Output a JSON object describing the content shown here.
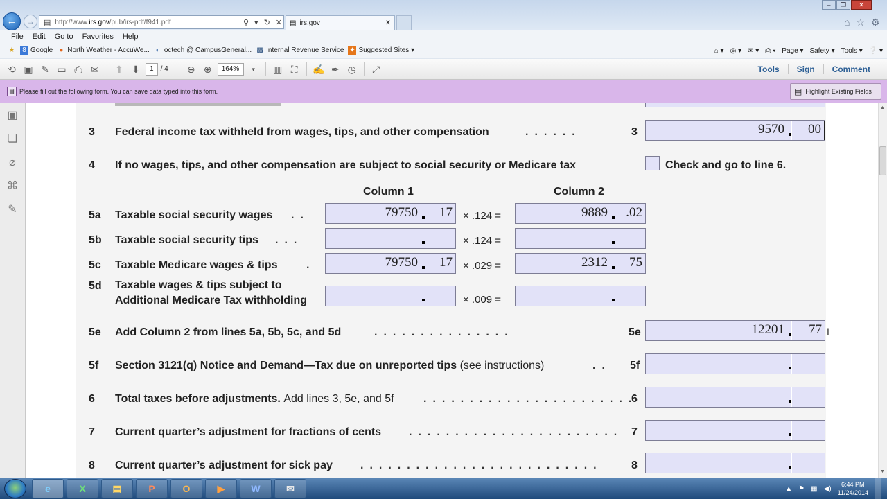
{
  "browser": {
    "url_prefix": "http://www.",
    "url_host": "irs.gov",
    "url_path": "/pub/irs-pdf/f941.pdf",
    "tab_title": "irs.gov",
    "search_glyph": "⚲",
    "refresh_glyph": "↻",
    "close_glyph": "✕"
  },
  "menu": [
    "File",
    "Edit",
    "Go to",
    "Favorites",
    "Help"
  ],
  "favorites": [
    "Google",
    "North Weather - AccuWe...",
    "octech @ CampusGeneral...",
    "Internal Revenue Service",
    "Suggested Sites ▾"
  ],
  "command_bar": [
    "Page ▾",
    "Safety ▾",
    "Tools ▾",
    "❔ ▾"
  ],
  "pdf_toolbar": {
    "page_current": "1",
    "page_total": "/ 4",
    "zoom": "164%",
    "tools": "Tools",
    "sign": "Sign",
    "comment": "Comment"
  },
  "notice": {
    "text": "Please fill out the following form. You can save data typed into this form.",
    "highlight_button": "Highlight Existing Fields"
  },
  "form": {
    "line3": {
      "num": "3",
      "label": "Federal income tax withheld from wages, tips, and other compensation",
      "ref": "3",
      "dollars": "9570",
      "cents": "00"
    },
    "line4": {
      "num": "4",
      "label": "If no wages, tips, and other compensation are subject to social security or Medicare tax",
      "check_label": "Check and go to line 6."
    },
    "col1": "Column 1",
    "col2": "Column 2",
    "line5a": {
      "num": "5a",
      "label": "Taxable social security wages",
      "mult": "× .124 =",
      "c1_dollars": "79750",
      "c1_cents": "17",
      "c2_dollars": "9889",
      "c2_cents": ".02"
    },
    "line5b": {
      "num": "5b",
      "label": "Taxable social security tips",
      "mult": "× .124 =",
      "c1_dollars": "",
      "c1_cents": "",
      "c2_dollars": "",
      "c2_cents": ""
    },
    "line5c": {
      "num": "5c",
      "label": "Taxable Medicare wages & tips",
      "mult": "× .029 =",
      "c1_dollars": "79750",
      "c1_cents": "17",
      "c2_dollars": "2312",
      "c2_cents": "75"
    },
    "line5d": {
      "num": "5d",
      "label1": "Taxable wages & tips subject to",
      "label2": "Additional Medicare Tax withholding",
      "mult": "× .009 =",
      "c1_dollars": "",
      "c1_cents": "",
      "c2_dollars": "",
      "c2_cents": ""
    },
    "line5e": {
      "num": "5e",
      "label": "Add Column 2 from lines 5a, 5b, 5c, and 5d",
      "ref": "5e",
      "dollars": "12201",
      "cents": "77"
    },
    "line5f": {
      "num": "5f",
      "label": "Section 3121(q) Notice and Demand—Tax due on unreported tips",
      "label_note": "(see instructions)",
      "ref": "5f",
      "dollars": "",
      "cents": ""
    },
    "line6": {
      "num": "6",
      "label": "Total taxes before adjustments.",
      "label_note": "Add lines 3, 5e, and 5f",
      "ref": "6",
      "dollars": "",
      "cents": ""
    },
    "line7": {
      "num": "7",
      "label": "Current quarter’s adjustment for fractions of cents",
      "ref": "7",
      "dollars": "",
      "cents": ""
    },
    "line8": {
      "num": "8",
      "label": "Current quarter’s adjustment for sick pay",
      "ref": "8",
      "dollars": "",
      "cents": ""
    }
  },
  "taskbar": {
    "apps": [
      "e",
      "X",
      "▤",
      "P",
      "O",
      "▶",
      "W",
      "✉"
    ],
    "time": "6:44 PM",
    "date": "11/24/2014"
  }
}
